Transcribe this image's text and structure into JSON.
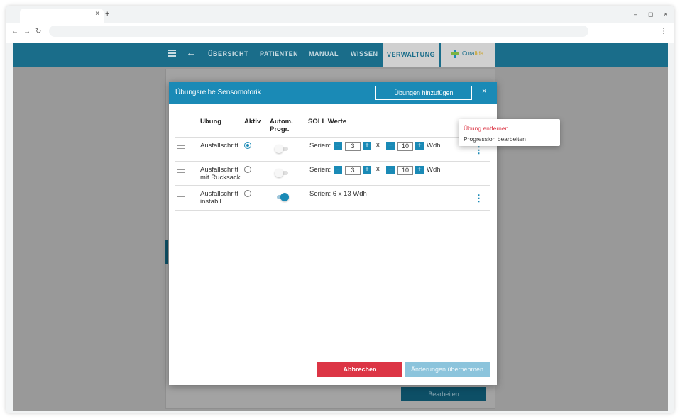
{
  "browser": {
    "tab_close": "×",
    "new_tab": "+",
    "back": "←",
    "forward": "→",
    "reload": "↻",
    "menu": "⋮",
    "minimize": "–",
    "restore": "◻",
    "close": "×"
  },
  "appbar": {
    "back_icon": "←",
    "nav": [
      "ÜBERSICHT",
      "PATIENTEN",
      "MANUAL",
      "WISSEN",
      "VERWALTUNG"
    ],
    "active_nav": "VERWALTUNG",
    "logo_text_1": "Cura",
    "logo_text_2": "fida"
  },
  "background": {
    "button_label": "Bearbeiten"
  },
  "dialog": {
    "title": "Übungsreihe Sensomotorik",
    "add_button": "Übungen hinzufügen",
    "close_icon": "×",
    "headers": {
      "exercise": "Übung",
      "active": "Aktiv",
      "auto_progression_1": "Autom.",
      "auto_progression_2": "Progr.",
      "target_values": "SOLL Werte"
    },
    "rows": [
      {
        "name_1": "Ausfallschritt",
        "name_2": "",
        "active": true,
        "auto_progression": false,
        "series_label": "Serien:",
        "sets": "3",
        "times_label": "x",
        "reps": "10",
        "reps_unit": "Wdh",
        "summary": ""
      },
      {
        "name_1": "Ausfallschritt",
        "name_2": "mit Rucksack",
        "active": false,
        "auto_progression": false,
        "series_label": "Serien:",
        "sets": "3",
        "times_label": "x",
        "reps": "10",
        "reps_unit": "Wdh",
        "summary": ""
      },
      {
        "name_1": "Ausfallschritt",
        "name_2": "instabil",
        "active": false,
        "auto_progression": true,
        "summary": "Serien: 6 x 13 Wdh"
      }
    ],
    "minus": "−",
    "plus": "+",
    "more_icon": "⋮",
    "cancel_button": "Abbrechen",
    "apply_button": "Änderungen übernehmen"
  },
  "context_menu": {
    "remove": "Übung entfernen",
    "edit_progression": "Progression bearbeiten"
  },
  "colors": {
    "appbar": "#1a6d8a",
    "primary": "#1a8ab6",
    "danger": "#dc3545",
    "apply_disabled": "#8cc4dc"
  }
}
